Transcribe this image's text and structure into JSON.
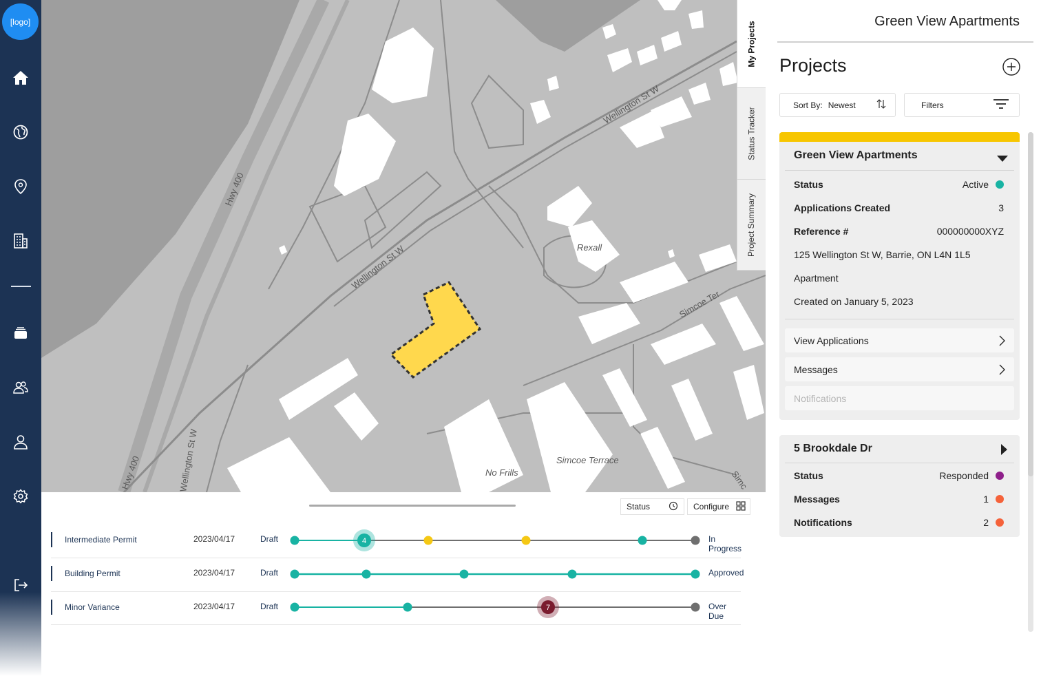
{
  "brand": {
    "logo_text": "[logo]",
    "nav_color": "#1c3354"
  },
  "nav": {
    "items": [
      {
        "name": "home",
        "icon": "home-icon"
      },
      {
        "name": "globe",
        "icon": "globe-icon"
      },
      {
        "name": "location",
        "icon": "map-pin-icon"
      },
      {
        "name": "buildings",
        "icon": "building-icon"
      },
      {
        "name": "stack",
        "icon": "stack-icon"
      },
      {
        "name": "users",
        "icon": "users-icon"
      },
      {
        "name": "profile",
        "icon": "user-icon"
      },
      {
        "name": "settings",
        "icon": "gear-icon"
      },
      {
        "name": "logout",
        "icon": "logout-icon"
      }
    ]
  },
  "map": {
    "labels": {
      "hwy_400_north": "Hwy 400",
      "hwy_400_south": "Hwy 400",
      "wellington_ne": "Wellington St W",
      "wellington_mid": "Wellington St W",
      "wellington_sw": "Wellington St W",
      "rexall": "Rexall",
      "simcoe_ter": "Simcoe Ter",
      "simcoe_terrace": "Simcoe Terrace",
      "no_frills": "No Frills",
      "simc": "Simc"
    },
    "highlight_color": "#ffd84d"
  },
  "side_tabs": [
    {
      "label": "My Projects",
      "active": true
    },
    {
      "label": "Status Tracker",
      "active": false
    },
    {
      "label": "Project Summary",
      "active": false
    }
  ],
  "timeline": {
    "toolbar": {
      "status_label": "Status",
      "configure_label": "Configure"
    },
    "rows": [
      {
        "name": "Intermediate Permit",
        "date": "2023/04/17",
        "start": "Draft",
        "end": "In Progress",
        "badge": "4"
      },
      {
        "name": "Building Permit",
        "date": "2023/04/17",
        "start": "Draft",
        "end": "Approved"
      },
      {
        "name": "Minor Variance",
        "date": "2023/04/17",
        "start": "Draft",
        "end": "Over Due",
        "badge": "7"
      }
    ],
    "colors": {
      "teal": "#18b3a3",
      "yellow": "#f5c814",
      "gray": "#6f6f6f",
      "overdue": "#7a1b2e"
    }
  },
  "panel": {
    "title": "Green View Apartments",
    "heading": "Projects",
    "sort": {
      "label": "Sort By:",
      "value": "Newest"
    },
    "filters_label": "Filters",
    "cards": [
      {
        "title": "Green View Apartments",
        "status_label": "Status",
        "status_value": "Active",
        "status_color": "#18b3a3",
        "apps_label": "Applications Created",
        "apps_value": "3",
        "ref_label": "Reference #",
        "ref_value": "000000000XYZ",
        "address": "125 Wellington St W, Barrie, ON L4N 1L5",
        "type": "Apartment",
        "created": "Created on January 5, 2023",
        "links": [
          "View Applications",
          "Messages",
          "Notifications"
        ]
      },
      {
        "title": "5 Brookdale Dr",
        "status_label": "Status",
        "status_value": "Responded",
        "status_color": "#8e1f8a",
        "messages_label": "Messages",
        "messages_value": "1",
        "notifications_label": "Notifications",
        "notifications_value": "2",
        "alert_color": "#f5623a"
      }
    ]
  }
}
